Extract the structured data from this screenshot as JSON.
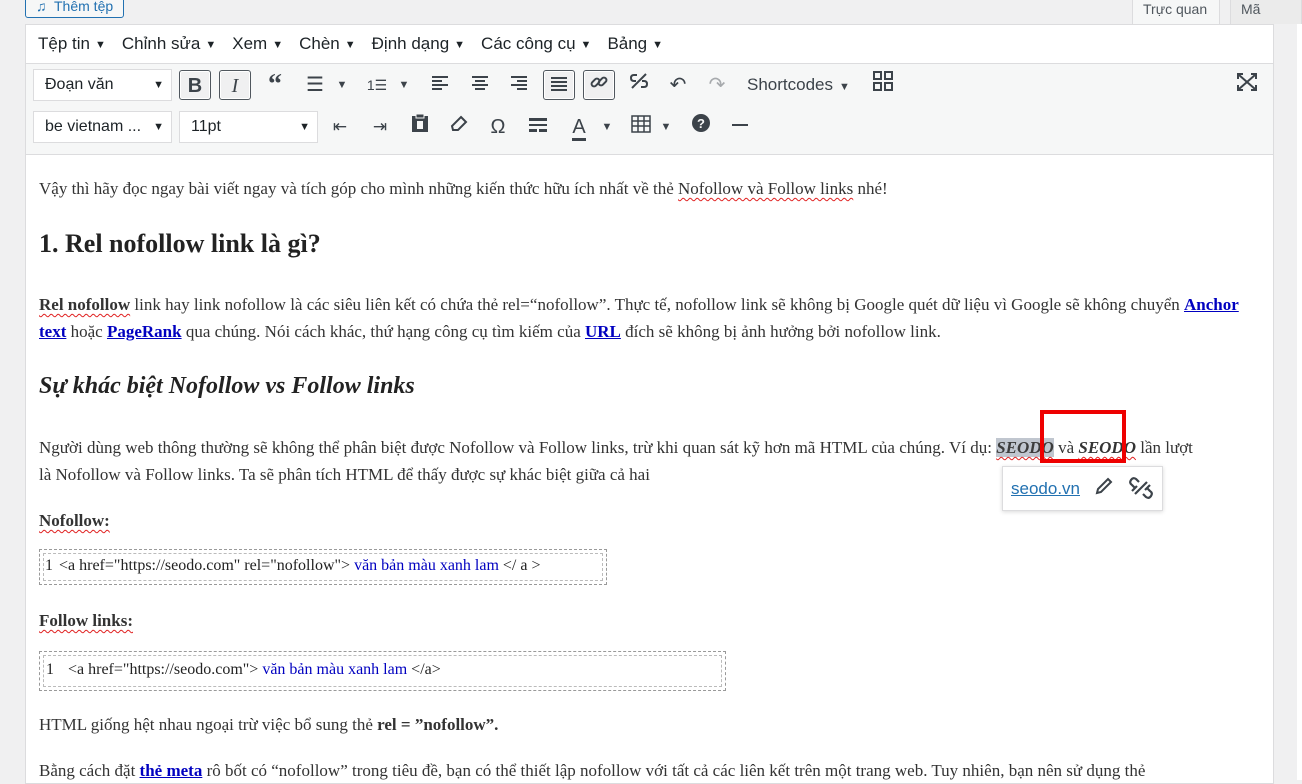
{
  "top": {
    "add_media": "Thêm tệp",
    "tab_visual": "Trực quan",
    "tab_text": "Mã"
  },
  "menubar": [
    "Tệp tin",
    "Chỉnh sửa",
    "Xem",
    "Chèn",
    "Định dạng",
    "Các công cụ",
    "Bảng"
  ],
  "toolbar": {
    "format_select": "Đoạn văn",
    "font_family_select": "be vietnam ...",
    "font_size_select": "11pt",
    "shortcodes": "Shortcodes",
    "bold": "B",
    "italic": "I"
  },
  "content": {
    "intro": {
      "t1": "Vậy thì hãy đọc ngay bài viết ngay và tích góp cho mình những kiến thức hữu ích nhất về thẻ ",
      "t2": "Nofollow và Follow links",
      "t3": " nhé!"
    },
    "h1": "1. Rel nofollow link là gì?",
    "para1": {
      "a": "Rel nofollow",
      "b": " link hay link nofollow là các siêu liên kết có chứa thẻ rel=“nofollow”. Thực tế, nofollow link sẽ không bị Google quét dữ liệu vì Google sẽ không chuyển ",
      "l1": "Anchor text",
      "c": " hoặc ",
      "l2": "PageRank",
      "d": " qua chúng. Nói cách khác, thứ hạng công cụ tìm kiếm của ",
      "l3": "URL",
      "e": " đích sẽ không bị ảnh hưởng bởi nofollow link."
    },
    "h2": "Sự khác biệt Nofollow vs Follow links",
    "para2": {
      "a": "Người dùng web thông thường sẽ không thể phân biệt được Nofollow và Follow links, trừ khi quan sát kỹ hơn mã HTML của chúng. Ví dụ: ",
      "s1": "SEODO",
      "b": " và ",
      "s2": "SEODO",
      "c": " lần lượt",
      "d": "là Nofollow và Follow links. Ta sẽ phân tích HTML để thấy được sự khác biệt giữa cả hai"
    },
    "nofollow_label": "Nofollow:",
    "code1": {
      "num": "1",
      "plain": "<a href=\"https://seodo.com\" rel=\"nofollow\">",
      "blue": " văn bản màu xanh lam",
      "end": " </ a >"
    },
    "follow_label": "Follow links:",
    "code2": {
      "num": "1",
      "plain": "<a href=\"https://seodo.com\">",
      "blue": " văn bản màu xanh lam",
      "end": " </a>"
    },
    "para3": {
      "a": "HTML giống hệt nhau ngoại trừ việc bổ sung thẻ ",
      "b": "rel = ”nofollow”."
    },
    "para4": {
      "a": "Bằng cách đặt ",
      "l": "thẻ meta",
      "b": " rô bốt có “nofollow” trong tiêu đề, bạn có thể thiết lập nofollow với tất cả các liên kết trên một trang web. Tuy nhiên, bạn nên sử dụng thẻ"
    }
  },
  "link_popover": {
    "url": "seodo.vn"
  }
}
